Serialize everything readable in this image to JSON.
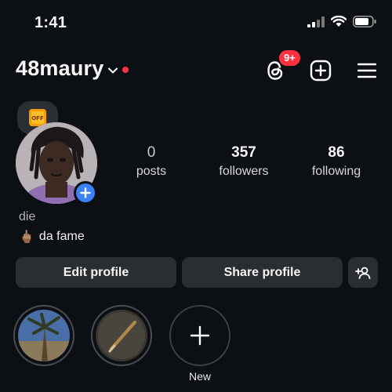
{
  "status_bar": {
    "time": "1:41"
  },
  "header": {
    "username": "48maury",
    "threads_badge": "9+"
  },
  "note": {
    "text": "OFF"
  },
  "stats": [
    {
      "value": "0",
      "label": "posts"
    },
    {
      "value": "357",
      "label": "followers"
    },
    {
      "value": "86",
      "label": "following"
    }
  ],
  "bio": {
    "name": "die",
    "emoji": "🖕🏽",
    "text": "da fame"
  },
  "buttons": {
    "edit": "Edit profile",
    "share": "Share profile"
  },
  "highlights": {
    "new_label": "New"
  },
  "colors": {
    "background": "#0c0f14",
    "button_bg": "#2a2d31",
    "badge_red": "#ff3040",
    "accent_blue": "#3b82f6"
  }
}
